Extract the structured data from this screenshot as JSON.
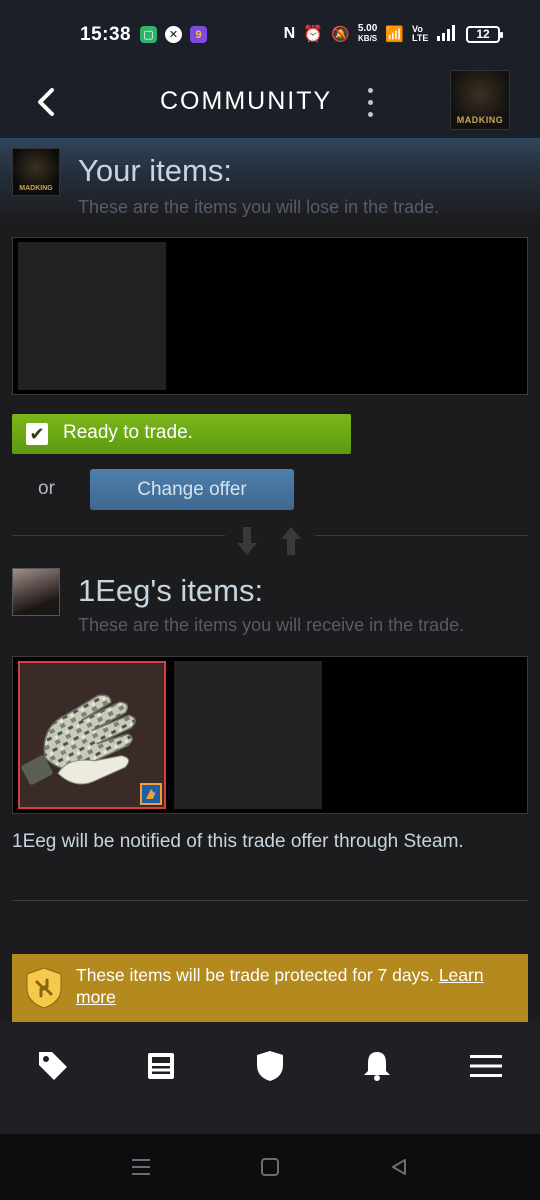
{
  "status_bar": {
    "time": "15:38",
    "net_speed_value": "5.00",
    "net_speed_unit": "KB/S",
    "volte": "Vo LTE",
    "battery": "12"
  },
  "header": {
    "title": "COMMUNITY",
    "avatar_text": "MADKING"
  },
  "your_items": {
    "title": "Your items:",
    "subtitle": "These are the items you will lose in the trade.",
    "avatar_text": "MADKING"
  },
  "actions": {
    "ready_label": "Ready to trade.",
    "ready_checked": true,
    "or_text": "or",
    "change_label": "Change offer"
  },
  "their_items": {
    "title": "1Eeg's items:",
    "subtitle": "These are the items you will receive in the trade.",
    "notify_text": "1Eeg will be notified of this trade offer through Steam."
  },
  "protect": {
    "text": "These items will be trade protected for 7 days.",
    "link": "Learn more"
  },
  "bottom_nav": {
    "items": [
      "tag-icon",
      "news-icon",
      "shield-icon",
      "bell-icon",
      "menu-icon"
    ]
  },
  "colors": {
    "ready_green": "#6aa616",
    "change_blue": "#47749e",
    "protect_gold": "#b4891d",
    "item_border_red": "#d2413f"
  }
}
